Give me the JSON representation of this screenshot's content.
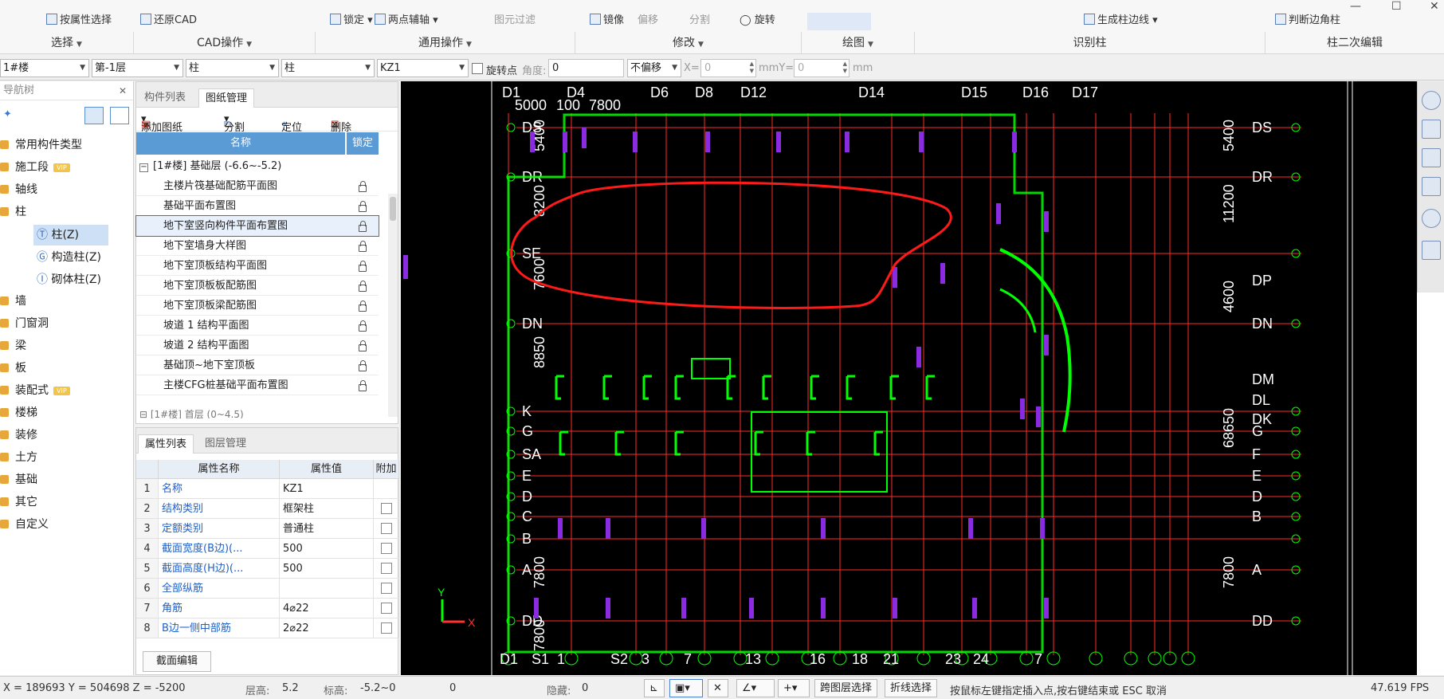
{
  "ribbon": {
    "top_items": [
      "按属性选择",
      "还原CAD",
      "锁定",
      "两点辅轴",
      "图元过滤",
      "镜像",
      "偏移",
      "分割",
      "旋转",
      "生成柱边线",
      "判断边角柱"
    ],
    "groups": [
      "选择",
      "CAD操作",
      "通用操作",
      "修改",
      "绘图",
      "识别柱",
      "柱二次编辑"
    ]
  },
  "selector": {
    "building": "1#楼",
    "floor": "第-1层",
    "type1": "柱",
    "type2": "柱",
    "element": "KZ1",
    "rotate_point_label": "旋转点",
    "angle_label": "角度:",
    "angle_value": "0",
    "offset": "不偏移",
    "x_label": "X=",
    "x_value": "0",
    "my_label": "mmY=",
    "y_value": "0",
    "mm_label": "mm"
  },
  "nav": {
    "title": "导航树",
    "items": [
      "常用构件类型",
      "施工段",
      "轴线",
      "柱",
      "墙",
      "门窗洞",
      "梁",
      "板",
      "装配式",
      "楼梯",
      "装修",
      "土方",
      "基础",
      "其它",
      "自定义"
    ],
    "vip_badge": "VIP",
    "sub_items": [
      "柱(Z)",
      "构造柱(Z)",
      "砌体柱(Z)"
    ]
  },
  "drawing_panel": {
    "tabs": [
      "构件列表",
      "图纸管理"
    ],
    "toolbar": [
      "添加图纸",
      "分割",
      "定位",
      "删除"
    ],
    "col_name": "名称",
    "col_lock": "锁定",
    "group": "[1#楼] 基础层 (-6.6~-5.2)",
    "rows": [
      "主楼片筏基础配筋平面图",
      "基础平面布置图",
      "地下室竖向构件平面布置图",
      "地下室墙身大样图",
      "地下室顶板结构平面图",
      "地下室顶板板配筋图",
      "地下室顶板梁配筋图",
      "坡道 1 结构平面图",
      "坡道 2 结构平面图",
      "基础顶~地下室顶板",
      "主楼CFG桩基础平面布置图"
    ]
  },
  "prop_panel": {
    "tabs": [
      "属性列表",
      "图层管理"
    ],
    "headers": [
      "属性名称",
      "属性值",
      "附加"
    ],
    "rows": [
      {
        "idx": "1",
        "name": "名称",
        "value": "KZ1",
        "check": false
      },
      {
        "idx": "2",
        "name": "结构类别",
        "value": "框架柱",
        "check": true
      },
      {
        "idx": "3",
        "name": "定额类别",
        "value": "普通柱",
        "check": true
      },
      {
        "idx": "4",
        "name": "截面宽度(B边)(...",
        "value": "500",
        "check": true
      },
      {
        "idx": "5",
        "name": "截面高度(H边)(...",
        "value": "500",
        "check": true
      },
      {
        "idx": "6",
        "name": "全部纵筋",
        "value": "",
        "check": true
      },
      {
        "idx": "7",
        "name": "角筋",
        "value": "4⌀22",
        "check": true
      },
      {
        "idx": "8",
        "name": "B边一侧中部筋",
        "value": "2⌀22",
        "check": true
      }
    ],
    "section_button": "截面编辑"
  },
  "canvas": {
    "row_axes_left": [
      "DS",
      "DR",
      "SE",
      "DN",
      "K",
      "G",
      "SA",
      "E",
      "D",
      "C",
      "B",
      "A",
      "DD"
    ],
    "row_axes_right": [
      "DS",
      "DR",
      "DP",
      "DN",
      "DM",
      "DL",
      "DK",
      "G",
      "F",
      "E",
      "D",
      "B",
      "A",
      "DD"
    ],
    "top_axes": [
      "D1",
      "D4",
      "D6",
      "D8",
      "D12",
      "D14",
      "D15",
      "D16",
      "D17"
    ],
    "bottom_axes": [
      "D1",
      "S1",
      "1",
      "S2",
      "3",
      "7",
      "13",
      "16",
      "18",
      "21",
      "23",
      "24",
      "7"
    ],
    "dims_left": [
      "5400",
      "8200",
      "7600",
      "8850",
      "7800",
      "7800"
    ],
    "dims_right": [
      "5400",
      "11200",
      "4600",
      "68650",
      "7800"
    ],
    "top_dims": [
      "5000",
      "100",
      "7800"
    ],
    "total_dim": "68650",
    "ucs_y": "Y",
    "ucs_x": "X"
  },
  "status": {
    "coords": "X = 189693 Y = 504698 Z = -5200",
    "floor_height_label": "层高:",
    "floor_height": "5.2",
    "elev_label": "标高:",
    "elev": "-5.2~0",
    "zero": "0",
    "hidden_label": "隐藏:",
    "hidden": "0",
    "cross_layer": "跨图层选择",
    "polyline_select": "折线选择",
    "hint": "按鼠标左键指定插入点,按右键结束或 ESC 取消",
    "fps": "47.619 FPS"
  },
  "colors": {
    "accent": "#5b9bd5",
    "cad_green": "#00ff00",
    "cad_red": "#ff0000",
    "cad_purple": "#8a2be2",
    "annotation_red": "#ff1a1a"
  }
}
